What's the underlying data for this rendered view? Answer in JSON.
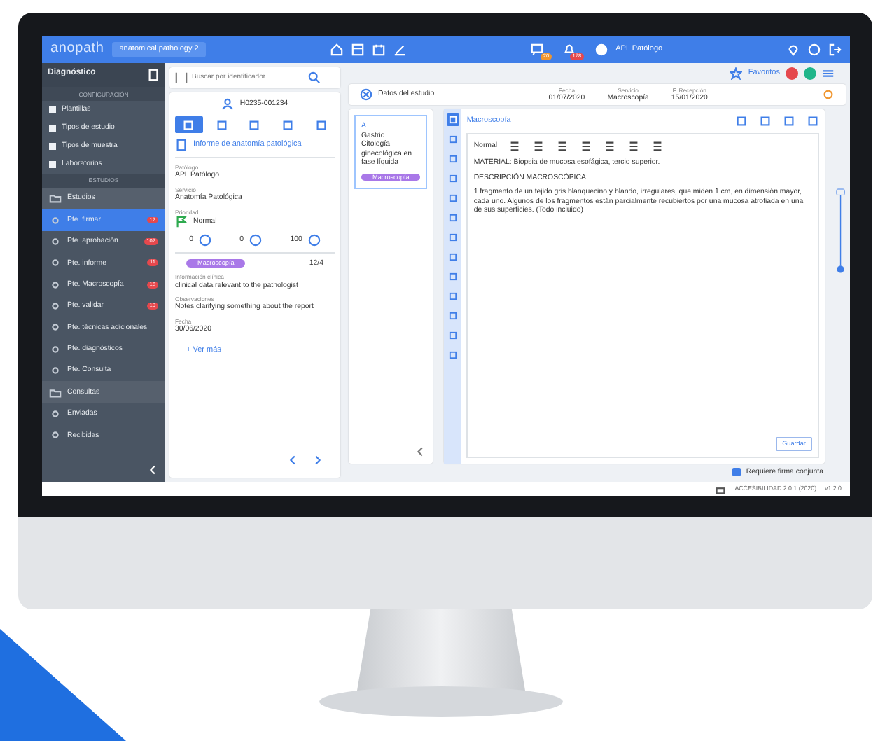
{
  "header": {
    "logo": "anopath",
    "case_tab": "anatomical pathology 2",
    "notification_counts": [
      "20",
      "178"
    ],
    "user": "APL Patólogo"
  },
  "sidebar": {
    "title": "Diagnóstico",
    "items": [
      {
        "kind": "heading",
        "label": "CONFIGURACIÓN"
      },
      {
        "kind": "config",
        "label": "Plantillas",
        "selected": false
      },
      {
        "kind": "config",
        "label": "Tipos de estudio",
        "selected": false
      },
      {
        "kind": "config",
        "label": "Tipos de muestra",
        "selected": false
      },
      {
        "kind": "config",
        "label": "Laboratorios",
        "selected": false
      },
      {
        "kind": "heading",
        "label": "ESTUDIOS"
      },
      {
        "kind": "group",
        "label": "Estudios",
        "selected": false
      },
      {
        "kind": "item",
        "label": "Pte. firmar",
        "badge": "12",
        "selected": true
      },
      {
        "kind": "item",
        "label": "Pte. aprobación",
        "badge": "102",
        "selected": false
      },
      {
        "kind": "item",
        "label": "Pte. informe",
        "badge": "11",
        "selected": false
      },
      {
        "kind": "item",
        "label": "Pte. Macroscopía",
        "badge": "16",
        "selected": false
      },
      {
        "kind": "item",
        "label": "Pte. validar",
        "badge": "10",
        "selected": false
      },
      {
        "kind": "item",
        "label": "Pte. técnicas adicionales",
        "selected": false
      },
      {
        "kind": "item",
        "label": "Pte. diagnósticos",
        "selected": false
      },
      {
        "kind": "item",
        "label": "Pte. Consulta",
        "selected": false
      },
      {
        "kind": "group",
        "label": "Consultas",
        "selected": false
      },
      {
        "kind": "item",
        "label": "Enviadas",
        "selected": false
      },
      {
        "kind": "item",
        "label": "Recibidas",
        "selected": false
      }
    ]
  },
  "case_panel": {
    "search": {
      "placeholder": "Buscar por identificador"
    },
    "case_id": "H0235-001234",
    "tabs": [
      {
        "selected": true
      },
      {
        "selected": false
      },
      {
        "selected": false
      },
      {
        "selected": false
      },
      {
        "selected": false
      }
    ],
    "report_link": "Informe de anatomía patológica",
    "fields": [
      {
        "label": "Patólogo",
        "value": "APL Patólogo"
      },
      {
        "label": "Servicio",
        "value": "Anatomía Patológica"
      }
    ],
    "priority": {
      "label": "Prioridad",
      "value": "Normal"
    },
    "counters": [
      "0",
      "0",
      "100"
    ],
    "status_tag": "Macroscopía",
    "count": "12/4",
    "notes": [
      {
        "label": "Información clínica",
        "value": "clinical data relevant to the pathologist"
      },
      {
        "label": "Observaciones",
        "value": "Notes clarifying something about the report"
      },
      {
        "label": "Fecha",
        "value": "30/06/2020"
      }
    ],
    "more_link": "+ Ver más"
  },
  "study": {
    "favorites": "Favoritos",
    "avatars": [
      {
        "color": "#e5484d"
      },
      {
        "color": "#1fb58a"
      }
    ],
    "tab": "Datos del estudio",
    "columns": [
      {
        "label": "Fecha",
        "value": "01/07/2020"
      },
      {
        "label": "Servicio",
        "value": "Macroscopía"
      },
      {
        "label": "F. Recepción",
        "value": "15/01/2020"
      }
    ],
    "specimen": {
      "letter": "A",
      "lines": [
        "Gastric",
        "Citología",
        "ginecológica en",
        "fase líquida"
      ],
      "tag": "Macroscopía"
    },
    "side_tools": [
      {
        "selected": true
      },
      {
        "selected": false
      },
      {
        "selected": false
      },
      {
        "selected": false
      },
      {
        "selected": false
      },
      {
        "selected": false
      },
      {
        "selected": false
      },
      {
        "selected": false
      },
      {
        "selected": false
      },
      {
        "selected": false
      },
      {
        "selected": false
      },
      {
        "selected": false
      },
      {
        "selected": false
      }
    ],
    "editor": {
      "title": "Macroscopía",
      "format": "Normal",
      "paragraphs": [
        "MATERIAL: Biopsia de mucosa esofágica, tercio superior.",
        "DESCRIPCIÓN MACROSCÓPICA:",
        "1 fragmento de un tejido gris blanquecino y blando, irregulares, que miden 1 cm, en dimensión mayor, cada uno. Algunos de los fragmentos están parcialmente recubiertos por una mucosa atrofiada en una de sus superficies. (Todo incluido)"
      ],
      "save": "Guardar"
    },
    "joint_signature": {
      "label": "Requiere firma conjunta",
      "checked": true
    }
  },
  "status_bar": {
    "text": "ACCESIBILIDAD 2.0.1 (2020)",
    "version": "v1.2.0"
  }
}
